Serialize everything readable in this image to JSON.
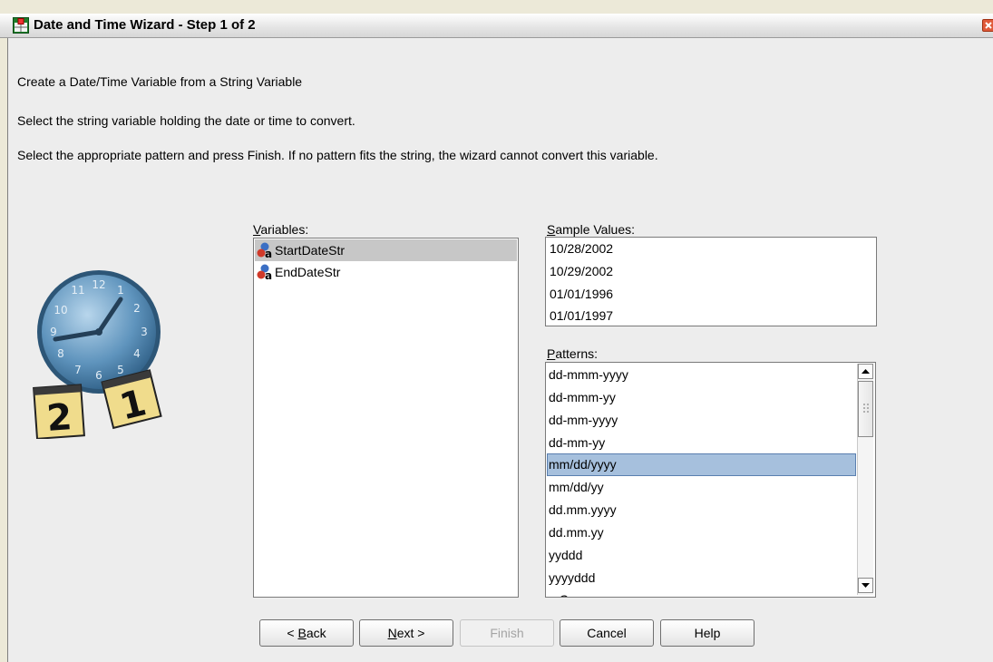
{
  "window": {
    "title": "Date and Time Wizard - Step 1 of 2"
  },
  "instructions": {
    "line1": "Create a Date/Time Variable from a String Variable",
    "line2": "Select the string variable holding the date or time to convert.",
    "line3": "Select the appropriate pattern and press Finish. If no pattern fits the string, the wizard cannot convert this variable."
  },
  "variables": {
    "label_mnemonic": "V",
    "label_rest": "ariables:",
    "items": [
      {
        "label": "StartDateStr",
        "selected": true
      },
      {
        "label": "EndDateStr",
        "selected": false
      }
    ]
  },
  "sample_values": {
    "label_mnemonic": "S",
    "label_rest": "ample Values:",
    "items": [
      "10/28/2002",
      "10/29/2002",
      "01/01/1996",
      "01/01/1997"
    ]
  },
  "patterns": {
    "label_mnemonic": "P",
    "label_rest": "atterns:",
    "items": [
      "dd-mmm-yyyy",
      "dd-mmm-yy",
      "dd-mm-yyyy",
      "dd-mm-yy",
      "mm/dd/yyyy",
      "mm/dd/yy",
      "dd.mm.yyyy",
      "dd.mm.yy",
      "yyddd",
      "yyyyddd",
      "q Q yyyy"
    ],
    "selected": "mm/dd/yyyy"
  },
  "buttons": {
    "back": {
      "prefix": "< ",
      "mnemonic": "B",
      "rest": "ack"
    },
    "next": {
      "mnemonic": "N",
      "rest": "ext >"
    },
    "finish": "Finish",
    "cancel": "Cancel",
    "help": "Help"
  },
  "clock_image": {
    "icon": "clock-calendar-icon",
    "calendar_pages": [
      "2",
      "1"
    ]
  },
  "colors": {
    "selection_highlight": "#a6c0dd",
    "variable_selection": "#c7c7c7",
    "client_background": "#ededed"
  }
}
